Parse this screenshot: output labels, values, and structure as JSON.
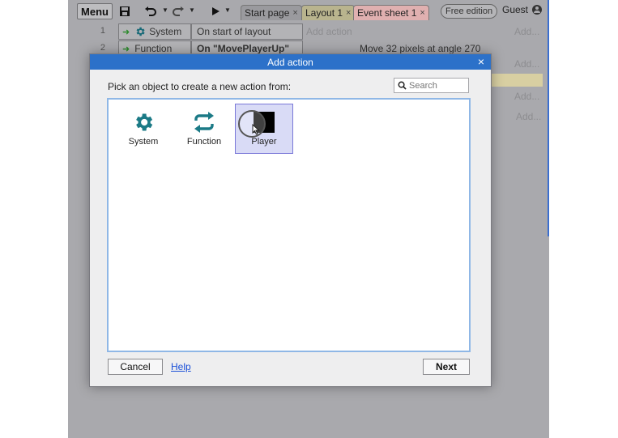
{
  "toolbar": {
    "menu_label": "Menu",
    "tabs": [
      {
        "label": "Start page",
        "bg": "#9a9a9e"
      },
      {
        "label": "Layout 1",
        "bg": "#b9b48e"
      },
      {
        "label": "Event sheet 1",
        "bg": "#e0b0b0"
      }
    ],
    "tab_close": "×",
    "free_badge": "Free edition",
    "user": "Guest"
  },
  "events": [
    {
      "num": "1",
      "object": "System",
      "condition": "On start of layout",
      "action": "Add action"
    },
    {
      "num": "2",
      "object": "Function",
      "condition": "On \"MovePlayerUp\"",
      "action": "Move 32 pixels at angle 270"
    }
  ],
  "background_add_label": "Add...",
  "dialog": {
    "title": "Add action",
    "close": "×",
    "prompt": "Pick an object to create a new action from:",
    "search_placeholder": "Search",
    "objects": [
      {
        "label": "System",
        "icon": "gear-icon",
        "color": "#1b7a86"
      },
      {
        "label": "Function",
        "icon": "function-arrows-icon",
        "color": "#1b7a86"
      },
      {
        "label": "Player",
        "icon": "sprite-icon",
        "selected": true
      }
    ],
    "cancel_label": "Cancel",
    "help_label": "Help",
    "next_label": "Next"
  }
}
